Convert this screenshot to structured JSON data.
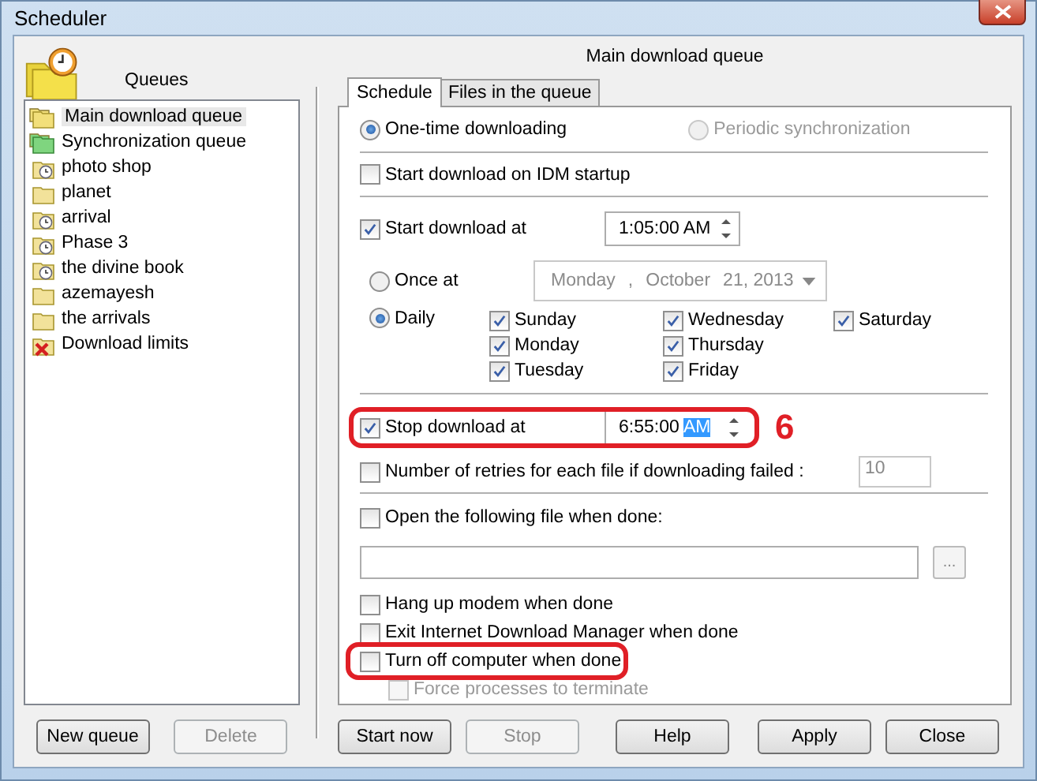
{
  "window": {
    "title": "Scheduler"
  },
  "queues": {
    "heading": "Queues",
    "items": [
      {
        "label": "Main download queue",
        "kind": "main",
        "selected": true
      },
      {
        "label": "Synchronization queue",
        "kind": "sync",
        "selected": false
      },
      {
        "label": "photo shop",
        "kind": "timed",
        "selected": false
      },
      {
        "label": "planet",
        "kind": "plain",
        "selected": false
      },
      {
        "label": "arrival",
        "kind": "timed",
        "selected": false
      },
      {
        "label": "Phase 3",
        "kind": "timed",
        "selected": false
      },
      {
        "label": "the divine book",
        "kind": "timed",
        "selected": false
      },
      {
        "label": "azemayesh",
        "kind": "plain",
        "selected": false
      },
      {
        "label": "the arrivals",
        "kind": "plain",
        "selected": false
      },
      {
        "label": "Download limits",
        "kind": "limits",
        "selected": false
      }
    ]
  },
  "queue_buttons": [
    {
      "label": "New queue",
      "disabled": false
    },
    {
      "label": "Delete",
      "disabled": true
    }
  ],
  "queue_title": "Main download queue",
  "tabs": [
    {
      "label": "Schedule",
      "selected": true
    },
    {
      "label": "Files in the queue",
      "selected": false
    }
  ],
  "modes": [
    {
      "label": "One-time downloading",
      "selected": true,
      "disabled": false
    },
    {
      "label": "Periodic synchronization",
      "selected": false,
      "disabled": true
    }
  ],
  "start_on_startup": {
    "label": "Start download on IDM startup",
    "checked": false
  },
  "start_at": {
    "label": "Start download at",
    "checked": true,
    "time": "1:05:00 AM"
  },
  "once_at": {
    "label": "Once at",
    "selected": false,
    "date_parts": [
      "Monday",
      ",",
      "October",
      "21, 2013"
    ]
  },
  "daily": {
    "label": "Daily",
    "selected": true
  },
  "days": [
    {
      "label": "Sunday",
      "checked": true
    },
    {
      "label": "Monday",
      "checked": true
    },
    {
      "label": "Tuesday",
      "checked": true
    },
    {
      "label": "Wednesday",
      "checked": true
    },
    {
      "label": "Thursday",
      "checked": true
    },
    {
      "label": "Friday",
      "checked": true
    },
    {
      "label": "Saturday",
      "checked": true
    }
  ],
  "stop_at": {
    "label": "Stop download at",
    "checked": true,
    "time": "6:55:00",
    "time_selected": "AM",
    "highlighted": true
  },
  "retries": {
    "label": "Number of retries for each file if downloading failed :",
    "checked": false,
    "value": "10"
  },
  "open_file": {
    "label": "Open the following file when done:",
    "checked": false,
    "browse": "..."
  },
  "done_options": [
    {
      "label": "Hang up modem when done",
      "checked": false,
      "disabled": false,
      "highlighted": false
    },
    {
      "label": "Exit Internet Download Manager when done",
      "checked": false,
      "disabled": false,
      "highlighted": false
    },
    {
      "label": "Turn off computer when done",
      "checked": false,
      "disabled": false,
      "highlighted": true,
      "children": [
        {
          "label": "Force processes to terminate",
          "checked": false,
          "disabled": true
        }
      ]
    }
  ],
  "annotation": "6",
  "buttons": [
    {
      "label": "Start now",
      "disabled": false
    },
    {
      "label": "Stop",
      "disabled": true
    },
    {
      "label": "Help",
      "disabled": false
    },
    {
      "label": "Apply",
      "disabled": false
    },
    {
      "label": "Close",
      "disabled": false
    }
  ]
}
